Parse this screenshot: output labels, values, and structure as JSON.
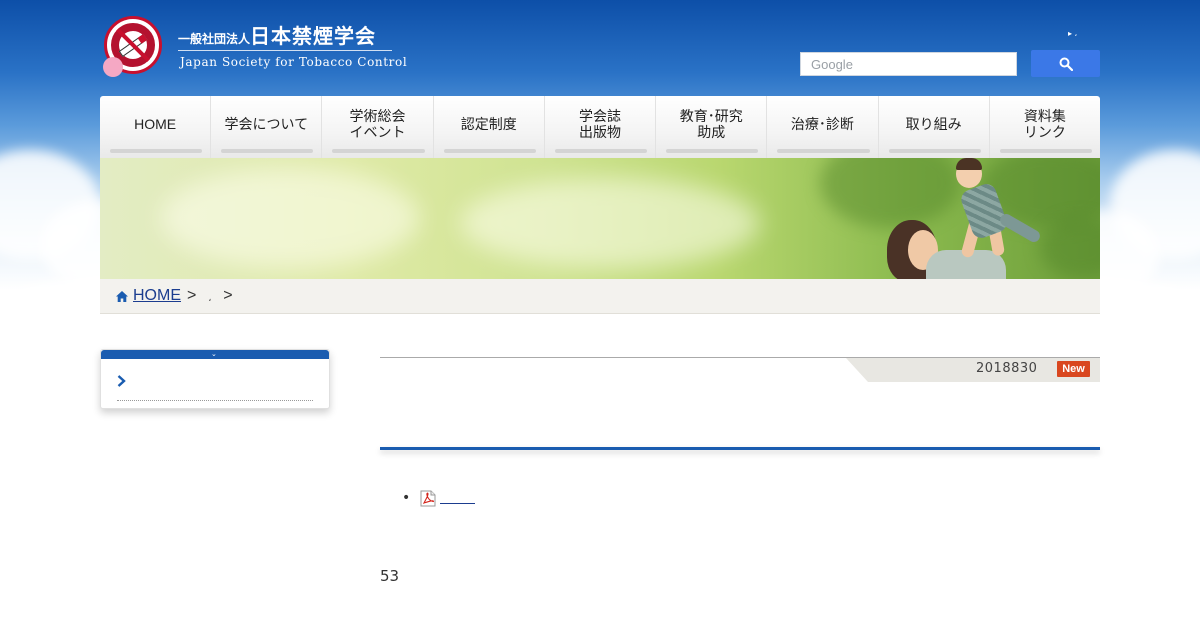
{
  "header": {
    "org_prefix": "一般社団法人",
    "org_name": "日本禁煙学会",
    "org_name_en": "Japan Society for Tobacco Control",
    "mini_links": [
      "▸ ،",
      "▸"
    ]
  },
  "search": {
    "placeholder": "Google",
    "button_icon": "search-icon"
  },
  "nav": {
    "items": [
      {
        "label": "HOME"
      },
      {
        "label": "学会について"
      },
      {
        "label": "学術総会\nイベント"
      },
      {
        "label": "認定制度"
      },
      {
        "label": "学会誌\n出版物"
      },
      {
        "label": "教育･研究\n助成"
      },
      {
        "label": "治療･診断"
      },
      {
        "label": "取り組み"
      },
      {
        "label": "資料集\nリンク"
      }
    ]
  },
  "breadcrumb": {
    "home_label": "HOME",
    "sep1": ">",
    "current": "،",
    "sep2": ">"
  },
  "sidebar": {
    "chevron": "⌄"
  },
  "article": {
    "date": "2018830",
    "badge": "New",
    "attachment_icon": "pdf-icon",
    "page_count": "53"
  },
  "colors": {
    "brand_blue": "#1a5cb0",
    "badge_red": "#d9471f",
    "search_blue": "#3b78e7"
  }
}
